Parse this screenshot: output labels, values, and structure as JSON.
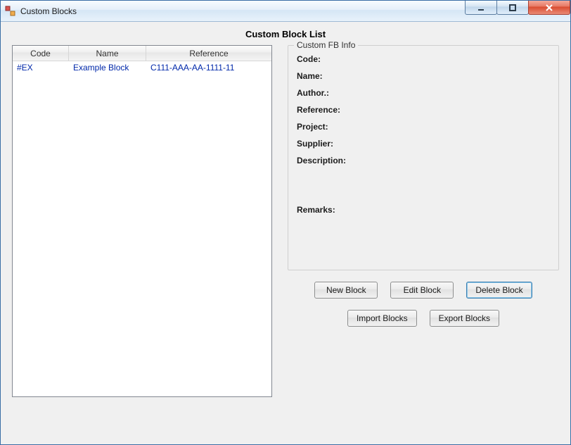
{
  "window": {
    "title": "Custom Blocks"
  },
  "heading": "Custom Block List",
  "table": {
    "headers": {
      "code": "Code",
      "name": "Name",
      "reference": "Reference"
    },
    "rows": [
      {
        "code": "#EX",
        "name": "Example Block",
        "reference": "C111-AAA-AA-1111-11"
      }
    ]
  },
  "info": {
    "legend": "Custom FB Info",
    "labels": {
      "code": "Code:",
      "name": "Name:",
      "author": "Author.:",
      "reference": "Reference:",
      "project": "Project:",
      "supplier": "Supplier:",
      "description": "Description:",
      "remarks": "Remarks:"
    },
    "values": {
      "code": "",
      "name": "",
      "author": "",
      "reference": "",
      "project": "",
      "supplier": "",
      "description": "",
      "remarks": ""
    }
  },
  "buttons": {
    "new": "New Block",
    "edit": "Edit Block",
    "delete": "Delete Block",
    "import": "Import Blocks",
    "export": "Export Blocks"
  }
}
